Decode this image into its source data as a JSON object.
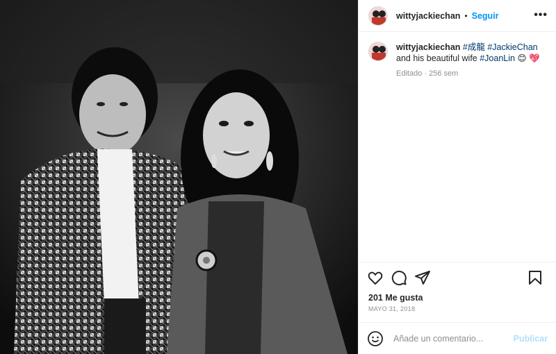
{
  "post": {
    "username": "wittyjackiechan",
    "follow_label": "Seguir",
    "separator": "•",
    "more_label": "•••"
  },
  "caption": {
    "username": "wittyjackiechan",
    "tag1": "#成龍",
    "tag2": "#JackieChan",
    "text": "and his beautiful wife",
    "tag3": "#JoanLin",
    "emoji": "😊 💖",
    "meta": "Editado · 256 sem"
  },
  "stats": {
    "likes": "201 Me gusta",
    "date": "MAYO 31, 2018"
  },
  "comment": {
    "placeholder": "Añade un comentario...",
    "publish_label": "Publicar"
  },
  "icons": [
    "heart-icon",
    "comment-icon",
    "share-icon",
    "bookmark-icon",
    "emoji-icon"
  ],
  "colors": {
    "link": "#0095f6",
    "hashtag": "#00376b",
    "muted": "#8e8e8e",
    "publish_disabled": "#b2dffc"
  }
}
